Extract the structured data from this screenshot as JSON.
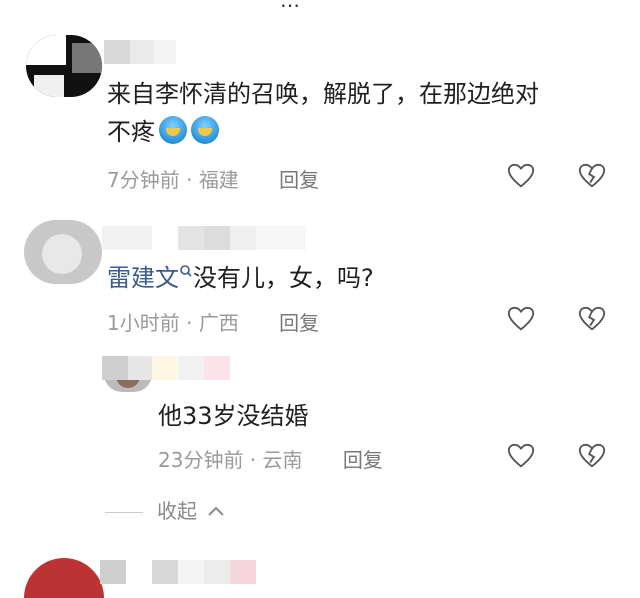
{
  "top_fragment": "…",
  "comments": [
    {
      "text_line1": "来自李怀清的召唤，解脱了，在那边绝对",
      "text_line2": "不疼",
      "time": "7分钟前",
      "location": "福建",
      "reply_label": "回复"
    },
    {
      "mention": "雷建文",
      "text": "没有儿，女，吗?",
      "time": "1小时前",
      "location": "广西",
      "reply_label": "回复"
    },
    {
      "text": "他33岁没结婚",
      "time": "23分钟前",
      "location": "云南",
      "reply_label": "回复"
    }
  ],
  "collapse_label": "收起",
  "colors": {
    "mention": "#3a5b8c",
    "meta": "#9a9a9a"
  },
  "icons": [
    "heart-icon",
    "broken-heart-icon",
    "search-small-icon",
    "chevron-up-icon"
  ]
}
